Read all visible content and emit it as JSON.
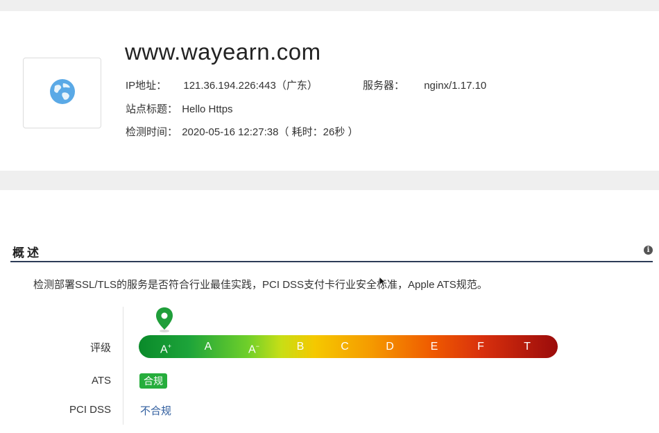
{
  "site": {
    "domain": "www.wayearn.com",
    "ip_label": "IP地址：",
    "ip_value": "121.36.194.226:443（广东）",
    "server_label": "服务器：",
    "server_value": "nginx/1.17.10",
    "title_label": "站点标题：",
    "title_value": "Hello Https",
    "time_label": "检测时间：",
    "time_value": "2020-05-16 12:27:38（ 耗时：26秒 ）",
    "icon": "globe-icon"
  },
  "overview": {
    "title": "概述",
    "info_icon": "info-icon",
    "description": "检测部署SSL/TLS的服务是否符合行业最佳实践，PCI DSS支付卡行业安全标准，Apple ATS规范。",
    "grade_label": "评级",
    "grades": [
      "A+",
      "A",
      "A-",
      "B",
      "C",
      "D",
      "E",
      "F",
      "T"
    ],
    "current_grade": "A+",
    "ats_label": "ATS",
    "ats_status": "合规",
    "pci_label": "PCI DSS",
    "pci_status": "不合规"
  },
  "colors": {
    "ats_badge": "#26ad3c",
    "pci_status": "#2f5d9e",
    "section_rule": "#2c3b57",
    "pin": "#1f9e3a"
  }
}
